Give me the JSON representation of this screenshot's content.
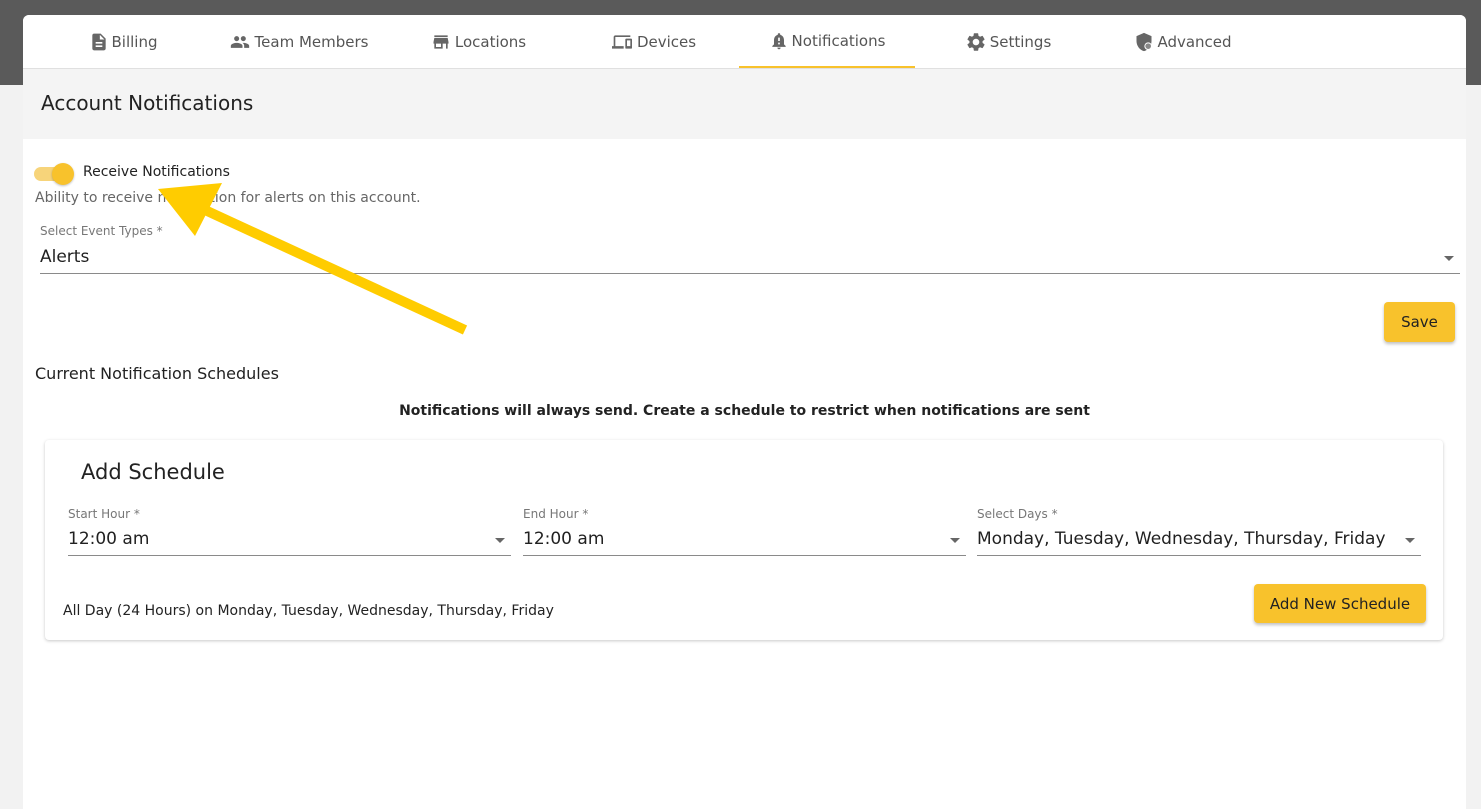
{
  "tabs": [
    {
      "label": "Billing",
      "icon": "document-icon"
    },
    {
      "label": "Team Members",
      "icon": "people-icon"
    },
    {
      "label": "Locations",
      "icon": "store-icon"
    },
    {
      "label": "Devices",
      "icon": "devices-icon"
    },
    {
      "label": "Notifications",
      "icon": "bell-alert-icon",
      "active": true
    },
    {
      "label": "Settings",
      "icon": "gear-icon"
    },
    {
      "label": "Advanced",
      "icon": "shield-icon"
    }
  ],
  "page": {
    "title": "Account Notifications"
  },
  "notifications": {
    "toggle_label": "Receive Notifications",
    "toggle_on": true,
    "helper": "Ability to receive notification for alerts on this account.",
    "event_types_label": "Select Event Types *",
    "event_types_value": "Alerts",
    "save_label": "Save"
  },
  "schedules": {
    "section_title": "Current Notification Schedules",
    "notice": "Notifications will always send. Create a schedule to restrict when notifications are sent",
    "add": {
      "title": "Add Schedule",
      "start_label": "Start Hour *",
      "start_value": "12:00 am",
      "end_label": "End Hour *",
      "end_value": "12:00 am",
      "days_label": "Select Days *",
      "days_value": "Monday, Tuesday, Wednesday, Thursday, Friday",
      "summary": "All Day (24 Hours) on Monday, Tuesday, Wednesday, Thursday, Friday",
      "button_label": "Add New Schedule"
    }
  },
  "colors": {
    "accent": "#f8c22c",
    "annotation_arrow": "#ffcc00"
  }
}
